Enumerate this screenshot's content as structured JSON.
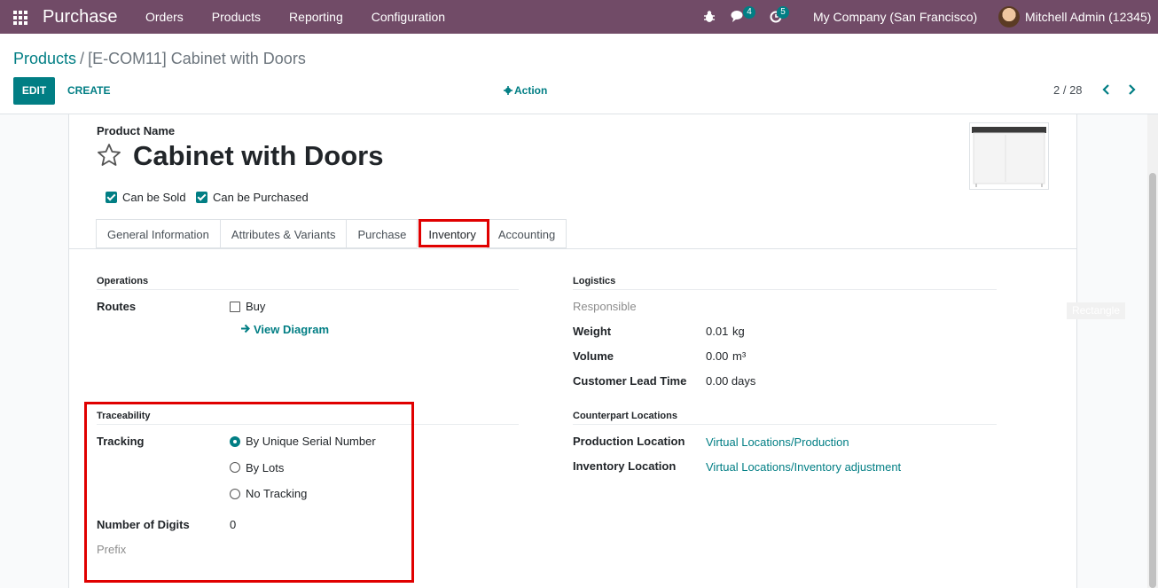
{
  "navbar": {
    "app_title": "Purchase",
    "menu": [
      "Orders",
      "Products",
      "Reporting",
      "Configuration"
    ],
    "chat_count": "4",
    "activity_count": "5",
    "company": "My Company (San Francisco)",
    "user": "Mitchell Admin (12345)"
  },
  "breadcrumb": {
    "parent": "Products",
    "separator": "/",
    "current": "[E-COM11] Cabinet with Doors"
  },
  "toolbar": {
    "edit_label": "EDIT",
    "create_label": "CREATE",
    "action_label": "Action",
    "pager": "2 / 28"
  },
  "product": {
    "name_label": "Product Name",
    "name": "Cabinet with Doors",
    "can_be_sold": "Can be Sold",
    "can_be_purchased": "Can be Purchased"
  },
  "tabs": [
    "General Information",
    "Attributes & Variants",
    "Purchase",
    "Inventory",
    "Accounting"
  ],
  "active_tab": "Inventory",
  "operations": {
    "title": "Operations",
    "routes_label": "Routes",
    "route_buy": "Buy",
    "view_diagram": "View Diagram"
  },
  "logistics": {
    "title": "Logistics",
    "responsible_label": "Responsible",
    "weight_label": "Weight",
    "weight_value": "0.01",
    "weight_unit": "kg",
    "volume_label": "Volume",
    "volume_value": "0.00",
    "volume_unit": "m³",
    "lead_time_label": "Customer Lead Time",
    "lead_time_value": "0.00 days"
  },
  "traceability": {
    "title": "Traceability",
    "tracking_label": "Tracking",
    "options": [
      "By Unique Serial Number",
      "By Lots",
      "No Tracking"
    ],
    "selected": "By Unique Serial Number",
    "digits_label": "Number of Digits",
    "digits_value": "0",
    "prefix_label": "Prefix"
  },
  "counterpart": {
    "title": "Counterpart Locations",
    "production_label": "Production Location",
    "production_value": "Virtual Locations/Production",
    "inventory_label": "Inventory Location",
    "inventory_value": "Virtual Locations/Inventory adjustment"
  },
  "overlay": {
    "rectangle_label": "Rectangle"
  },
  "colors": {
    "navbar": "#714b67",
    "accent": "#017e84",
    "highlight": "#e00000"
  }
}
